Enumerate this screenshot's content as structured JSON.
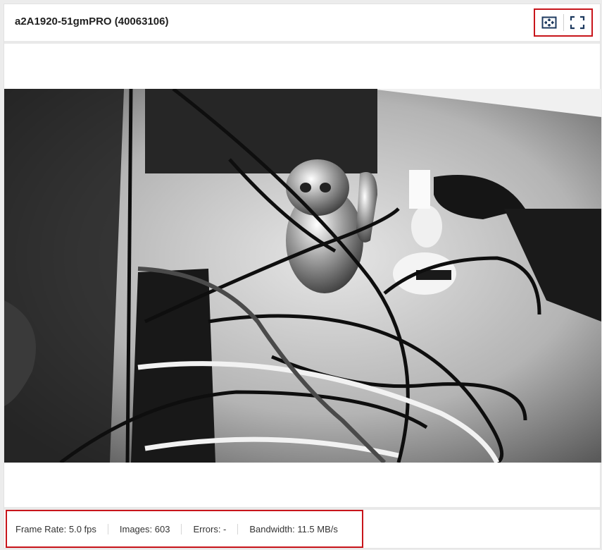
{
  "header": {
    "title": "a2A1920-51gmPRO (40063106)",
    "actions": [
      {
        "icon": "fit-to-view-icon"
      },
      {
        "icon": "fullscreen-icon"
      }
    ]
  },
  "viewer": {
    "image_description_icon": "camera-live-image"
  },
  "footer": {
    "frame_rate": "Frame Rate: 5.0 fps",
    "images": "Images: 603",
    "errors": "Errors: -",
    "bandwidth": "Bandwidth: 11.5 MB/s"
  },
  "colors": {
    "accent_border": "#c8151b",
    "icon_color": "#1e3a5f"
  }
}
